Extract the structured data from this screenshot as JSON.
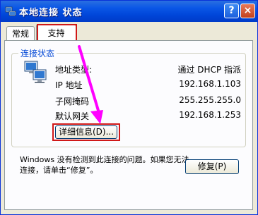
{
  "window": {
    "title": "本地连接 状态",
    "help_label": "?",
    "close_label": "×"
  },
  "tabs": [
    {
      "label": "常规"
    },
    {
      "label": "支持"
    }
  ],
  "group": {
    "title": "连接状态",
    "rows": [
      {
        "label": "地址类型:",
        "value": "通过 DHCP 指派"
      },
      {
        "label": "IP 地址",
        "value": "192.168.1.103"
      },
      {
        "label": "子网掩码",
        "value": "255.255.255.0"
      },
      {
        "label": "默认网关",
        "value": "192.168.1.253"
      }
    ],
    "details_button": "详细信息(D)..."
  },
  "message": "Windows 没有检测到此连接的问题。如果您无法连接，请单击“修复”。",
  "repair_button": "修复(P)",
  "icons": {
    "title": "network-connection-icon",
    "status": "network-computers-icon"
  },
  "colors": {
    "titlebar": "#0a56e6",
    "group_title": "#0046d5",
    "highlight_box": "#d01818",
    "arrow": "#ff00ff"
  }
}
